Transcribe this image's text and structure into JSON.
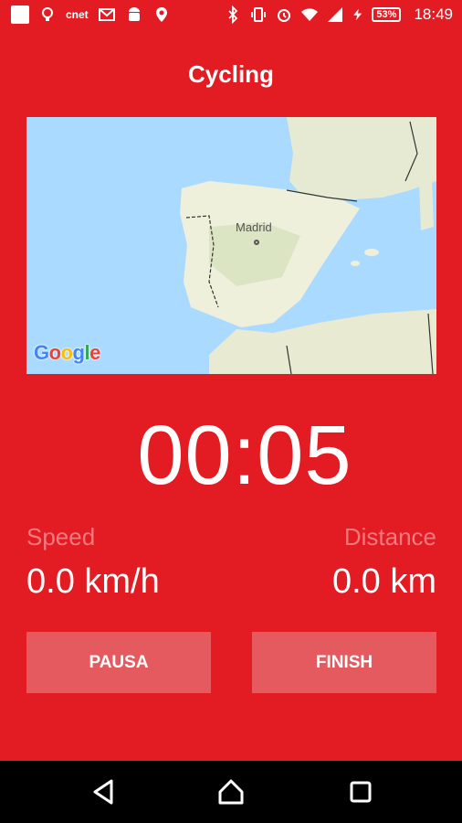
{
  "status_bar": {
    "battery": "53%",
    "time": "18:49",
    "icons": [
      "notification-square-icon",
      "lightbulb-icon",
      "cnet-icon",
      "gmail-icon",
      "android-icon",
      "location-icon",
      "bluetooth-icon",
      "vibrate-icon",
      "alarm-icon",
      "wifi-icon",
      "signal-icon",
      "charging-icon"
    ],
    "cnet_label": "cnet"
  },
  "header": {
    "title": "Cycling"
  },
  "map": {
    "city_label": "Madrid",
    "logo_text": "Google",
    "water_color": "#aadaff",
    "land_color": "#f1efe6"
  },
  "timer": {
    "value": "00:05"
  },
  "stats": {
    "speed_label": "Speed",
    "speed_value": "0.0 km/h",
    "distance_label": "Distance",
    "distance_value": "0.0 km"
  },
  "buttons": {
    "pause_label": "PAUSA",
    "finish_label": "FINISH"
  },
  "colors": {
    "background": "#e31b23",
    "button": "#e45a5f",
    "muted_text": "#f07a80"
  }
}
